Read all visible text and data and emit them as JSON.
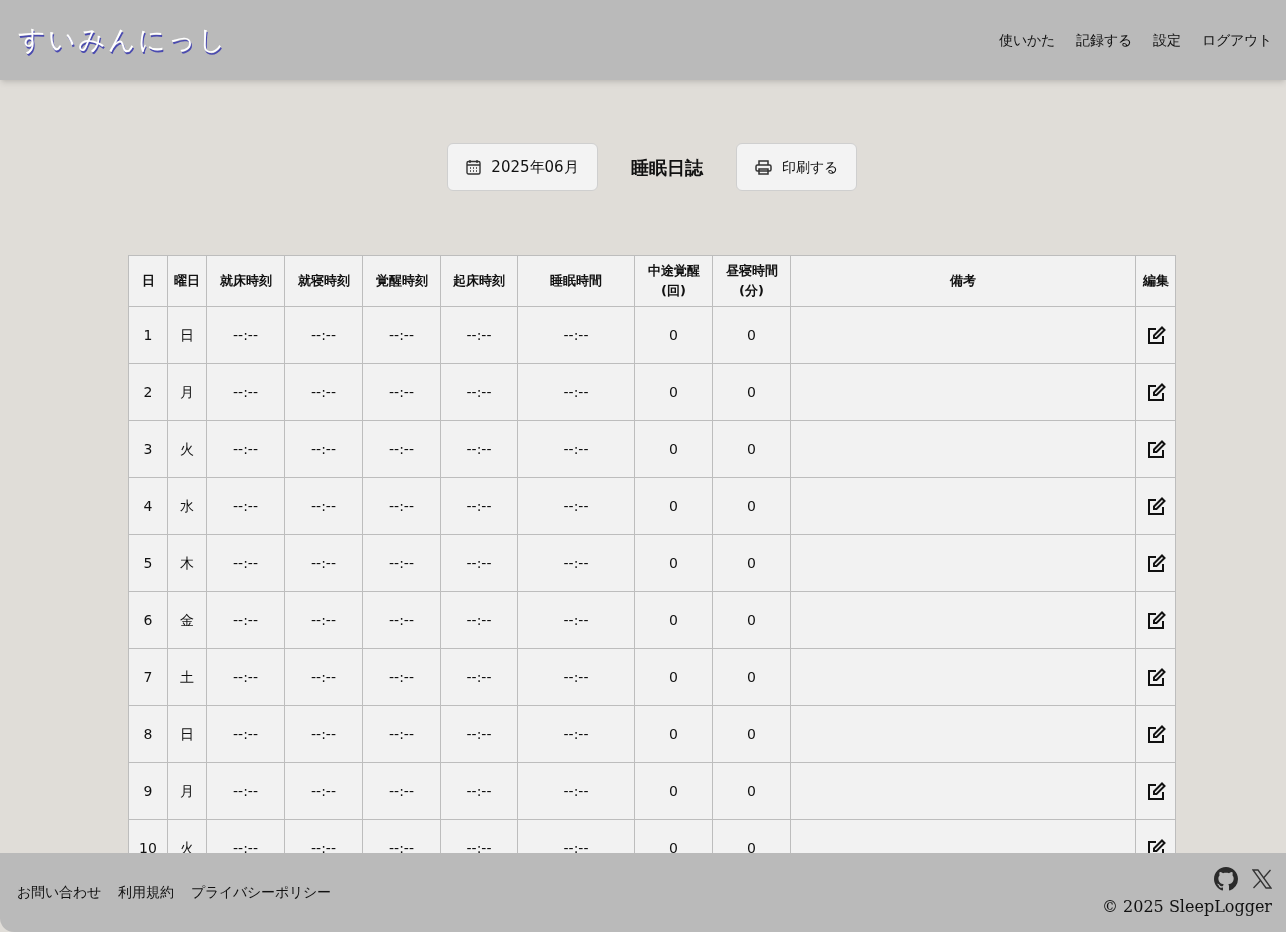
{
  "header": {
    "logo": "すいみんにっし",
    "nav": [
      "使いかた",
      "記録する",
      "設定",
      "ログアウト"
    ]
  },
  "toolbar": {
    "month_button": "2025年06月",
    "title": "睡眠日誌",
    "print_button": "印刷する"
  },
  "table": {
    "columns": [
      "日",
      "曜日",
      "就床時刻",
      "就寝時刻",
      "覚醒時刻",
      "起床時刻",
      "睡眠時間",
      "中途覚醒\n(回)",
      "昼寝時間\n(分)",
      "備考",
      "編集"
    ],
    "rows": [
      {
        "day": "1",
        "weekday": "日",
        "bed_time": "--:--",
        "sleep_time": "--:--",
        "wake_time": "--:--",
        "rise_time": "--:--",
        "sleep_duration": "--:--",
        "awakenings": "0",
        "nap": "0"
      },
      {
        "day": "2",
        "weekday": "月",
        "bed_time": "--:--",
        "sleep_time": "--:--",
        "wake_time": "--:--",
        "rise_time": "--:--",
        "sleep_duration": "--:--",
        "awakenings": "0",
        "nap": "0"
      },
      {
        "day": "3",
        "weekday": "火",
        "bed_time": "--:--",
        "sleep_time": "--:--",
        "wake_time": "--:--",
        "rise_time": "--:--",
        "sleep_duration": "--:--",
        "awakenings": "0",
        "nap": "0"
      },
      {
        "day": "4",
        "weekday": "水",
        "bed_time": "--:--",
        "sleep_time": "--:--",
        "wake_time": "--:--",
        "rise_time": "--:--",
        "sleep_duration": "--:--",
        "awakenings": "0",
        "nap": "0"
      },
      {
        "day": "5",
        "weekday": "木",
        "bed_time": "--:--",
        "sleep_time": "--:--",
        "wake_time": "--:--",
        "rise_time": "--:--",
        "sleep_duration": "--:--",
        "awakenings": "0",
        "nap": "0"
      },
      {
        "day": "6",
        "weekday": "金",
        "bed_time": "--:--",
        "sleep_time": "--:--",
        "wake_time": "--:--",
        "rise_time": "--:--",
        "sleep_duration": "--:--",
        "awakenings": "0",
        "nap": "0"
      },
      {
        "day": "7",
        "weekday": "土",
        "bed_time": "--:--",
        "sleep_time": "--:--",
        "wake_time": "--:--",
        "rise_time": "--:--",
        "sleep_duration": "--:--",
        "awakenings": "0",
        "nap": "0"
      },
      {
        "day": "8",
        "weekday": "日",
        "bed_time": "--:--",
        "sleep_time": "--:--",
        "wake_time": "--:--",
        "rise_time": "--:--",
        "sleep_duration": "--:--",
        "awakenings": "0",
        "nap": "0"
      },
      {
        "day": "9",
        "weekday": "月",
        "bed_time": "--:--",
        "sleep_time": "--:--",
        "wake_time": "--:--",
        "rise_time": "--:--",
        "sleep_duration": "--:--",
        "awakenings": "0",
        "nap": "0"
      },
      {
        "day": "10",
        "weekday": "火",
        "bed_time": "--:--",
        "sleep_time": "--:--",
        "wake_time": "--:--",
        "rise_time": "--:--",
        "sleep_duration": "--:--",
        "awakenings": "0",
        "nap": "0"
      }
    ]
  },
  "footer": {
    "links": [
      "お問い合わせ",
      "利用規約",
      "プライバシーポリシー"
    ],
    "copyright": "© 2025 SleepLogger"
  }
}
